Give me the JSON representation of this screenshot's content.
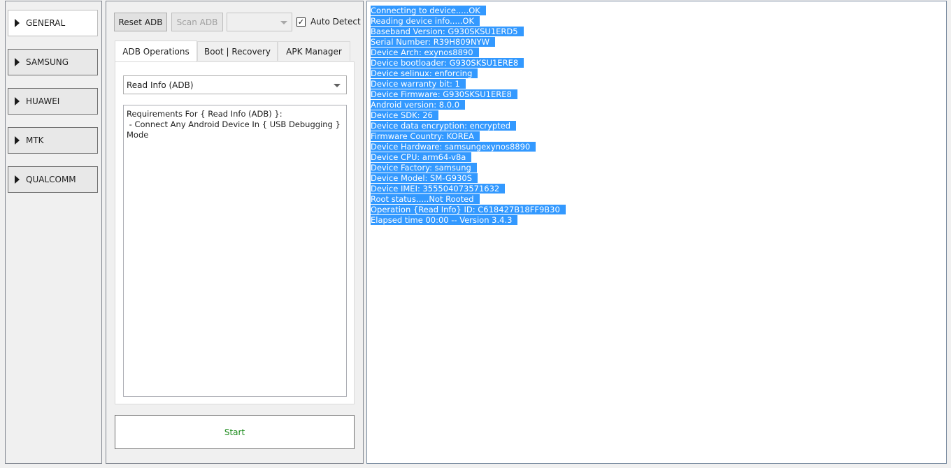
{
  "nav": {
    "items": [
      {
        "label": "GENERAL"
      },
      {
        "label": "SAMSUNG"
      },
      {
        "label": "HUAWEI"
      },
      {
        "label": "MTK"
      },
      {
        "label": "QUALCOMM"
      }
    ],
    "active_index": 0
  },
  "toolbar": {
    "reset_label": "Reset ADB",
    "scan_label": "Scan ADB",
    "port_combo_value": "",
    "auto_detect_label": "Auto Detect",
    "auto_detect_checked": true
  },
  "tabs": [
    {
      "label": "ADB Operations",
      "active": true
    },
    {
      "label": "Boot | Recovery",
      "active": false
    },
    {
      "label": "APK Manager",
      "active": false
    }
  ],
  "operation": {
    "selected": "Read Info (ADB)",
    "requirements": "Requirements For { Read Info (ADB) }:\n - Connect Any Android Device In { USB Debugging }\nMode"
  },
  "start_label": "Start",
  "log": [
    "Connecting to device.....OK",
    "Reading device info.....OK",
    "Baseband Version: G930SKSU1ERD5",
    "Serial Number: R39H809NYW",
    "Device Arch: exynos8890",
    "Device bootloader: G930SKSU1ERE8",
    "Device selinux: enforcing",
    "Device warranty bit: 1",
    "Device Firmware: G930SKSU1ERE8",
    "Android version: 8.0.0",
    "Device SDK: 26",
    "Device data encryption: encrypted",
    "Firmware Country: KOREA",
    "Device Hardware: samsungexynos8890",
    "Device CPU: arm64-v8a",
    "Device Factory: samsung",
    "Device Model: SM-G930S",
    "Device IMEI: 355504073571632",
    "Root status.....Not Rooted",
    "Operation {Read Info} ID: C618427B18FF9B30",
    "Elapsed time 00:00 -- Version 3.4.3"
  ],
  "colors": {
    "selection": "#3399ff",
    "start_text": "#1a8a1a"
  }
}
